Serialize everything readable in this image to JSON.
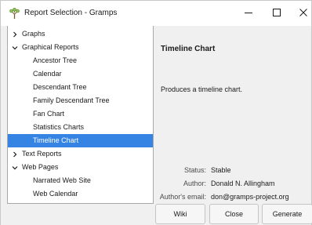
{
  "window": {
    "title": "Report Selection - Gramps",
    "icon": "gramps-tree-icon",
    "controls": {
      "minimize": "–",
      "maximize": "☐",
      "close": "✕"
    }
  },
  "tree": {
    "items": [
      {
        "label": "Graphs",
        "level": 0,
        "expander": "collapsed",
        "selected": false
      },
      {
        "label": "Graphical Reports",
        "level": 0,
        "expander": "expanded",
        "selected": false
      },
      {
        "label": "Ancestor Tree",
        "level": 1,
        "selected": false
      },
      {
        "label": "Calendar",
        "level": 1,
        "selected": false
      },
      {
        "label": "Descendant Tree",
        "level": 1,
        "selected": false
      },
      {
        "label": "Family Descendant Tree",
        "level": 1,
        "selected": false
      },
      {
        "label": "Fan Chart",
        "level": 1,
        "selected": false
      },
      {
        "label": "Statistics Charts",
        "level": 1,
        "selected": false
      },
      {
        "label": "Timeline Chart",
        "level": 1,
        "selected": true
      },
      {
        "label": "Text Reports",
        "level": 0,
        "expander": "collapsed",
        "selected": false
      },
      {
        "label": "Web Pages",
        "level": 0,
        "expander": "expanded",
        "selected": false
      },
      {
        "label": "Narrated Web Site",
        "level": 1,
        "selected": false
      },
      {
        "label": "Web Calendar",
        "level": 1,
        "selected": false
      }
    ]
  },
  "details": {
    "title": "Timeline Chart",
    "description": "Produces a timeline chart.",
    "status_label": "Status:",
    "status_value": "Stable",
    "author_label": "Author:",
    "author_value": "Donald N. Allingham",
    "email_label": "Author's email:",
    "email_value": "don@gramps-project.org"
  },
  "buttons": {
    "wiki": "Wiki",
    "close": "Close",
    "generate": "Generate"
  },
  "colors": {
    "selection": "#3584e4",
    "window_bg": "#f0f0f0",
    "pane_bg": "#ffffff"
  }
}
